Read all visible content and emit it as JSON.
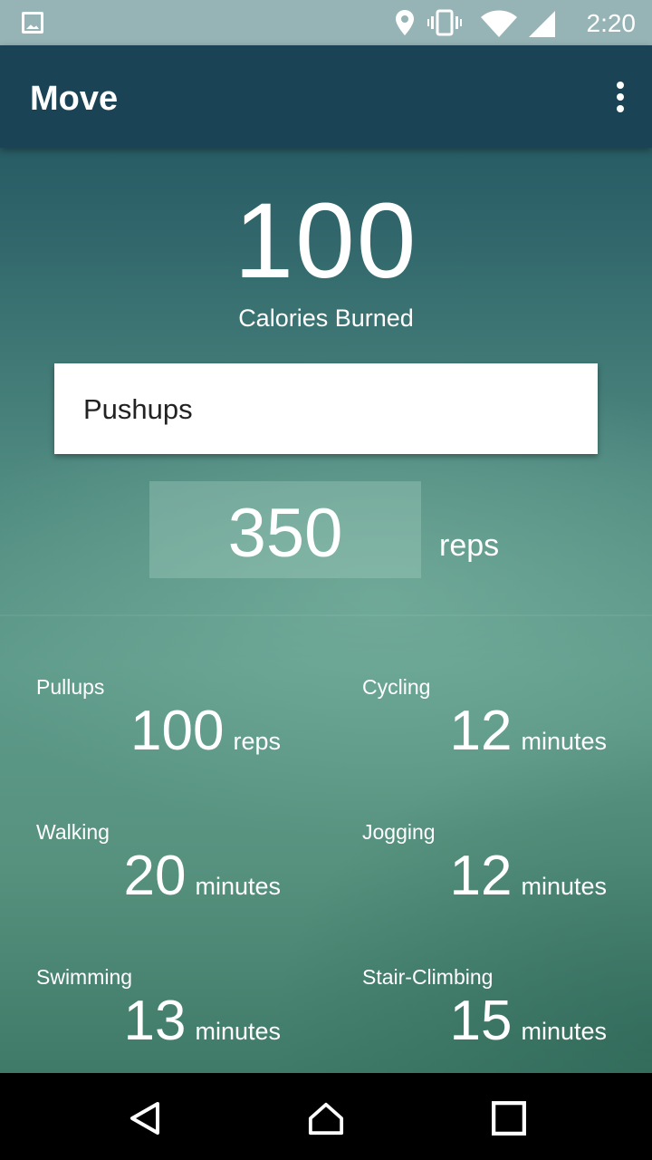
{
  "status_bar": {
    "time": "2:20",
    "icons": [
      "image-icon",
      "location-icon",
      "vibrate-icon",
      "wifi-icon",
      "signal-icon"
    ]
  },
  "app_bar": {
    "title": "Move",
    "menu_icon": "overflow-menu-icon"
  },
  "summary": {
    "calories": "100",
    "calories_label": "Calories Burned"
  },
  "input": {
    "exercise": "Pushups",
    "amount": "350",
    "unit": "reps"
  },
  "equivalents": [
    {
      "name": "Pullups",
      "value": "100",
      "unit": "reps"
    },
    {
      "name": "Cycling",
      "value": "12",
      "unit": "minutes"
    },
    {
      "name": "Walking",
      "value": "20",
      "unit": "minutes"
    },
    {
      "name": "Jogging",
      "value": "12",
      "unit": "minutes"
    },
    {
      "name": "Swimming",
      "value": "13",
      "unit": "minutes"
    },
    {
      "name": "Stair-Climbing",
      "value": "15",
      "unit": "minutes"
    }
  ],
  "nav_bar": {
    "icons": [
      "back-icon",
      "home-icon",
      "recents-icon"
    ]
  },
  "colors": {
    "app_bar": "#1a4455",
    "status_bar": "#96b3b5",
    "select_background": "#ffffff"
  }
}
